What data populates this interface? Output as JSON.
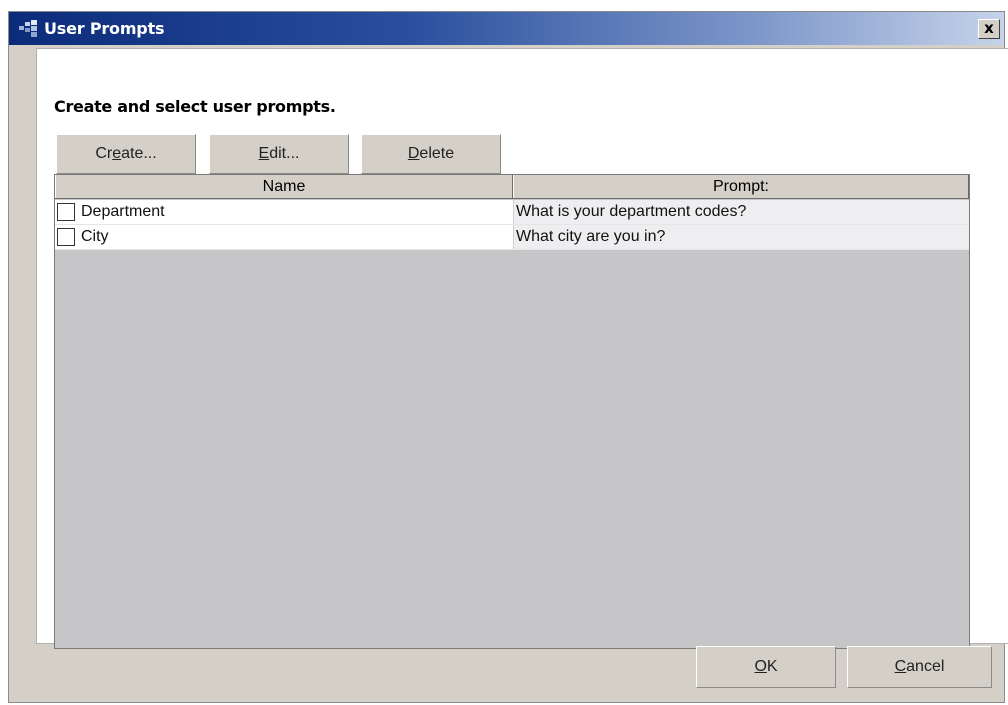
{
  "window": {
    "title": "User Prompts",
    "close_symbol": "x"
  },
  "panel": {
    "heading": "Create and select user prompts."
  },
  "toolbar": {
    "create": {
      "before": "Cr",
      "mnemonic": "e",
      "after": "ate..."
    },
    "edit": {
      "before": "",
      "mnemonic": "E",
      "after": "dit..."
    },
    "delete": {
      "before": "",
      "mnemonic": "D",
      "after": "elete"
    }
  },
  "table": {
    "columns": [
      "Name",
      "Prompt:"
    ],
    "rows": [
      {
        "name": "Department",
        "prompt": "What is your department codes?",
        "checked": false
      },
      {
        "name": "City",
        "prompt": "What city are you in?",
        "checked": false
      }
    ]
  },
  "footer": {
    "ok": {
      "before": "",
      "mnemonic": "O",
      "after": "K"
    },
    "cancel": {
      "before": "",
      "mnemonic": "C",
      "after": "ancel"
    }
  },
  "icons": {
    "app": "app-window-icon",
    "close": "close-icon"
  }
}
